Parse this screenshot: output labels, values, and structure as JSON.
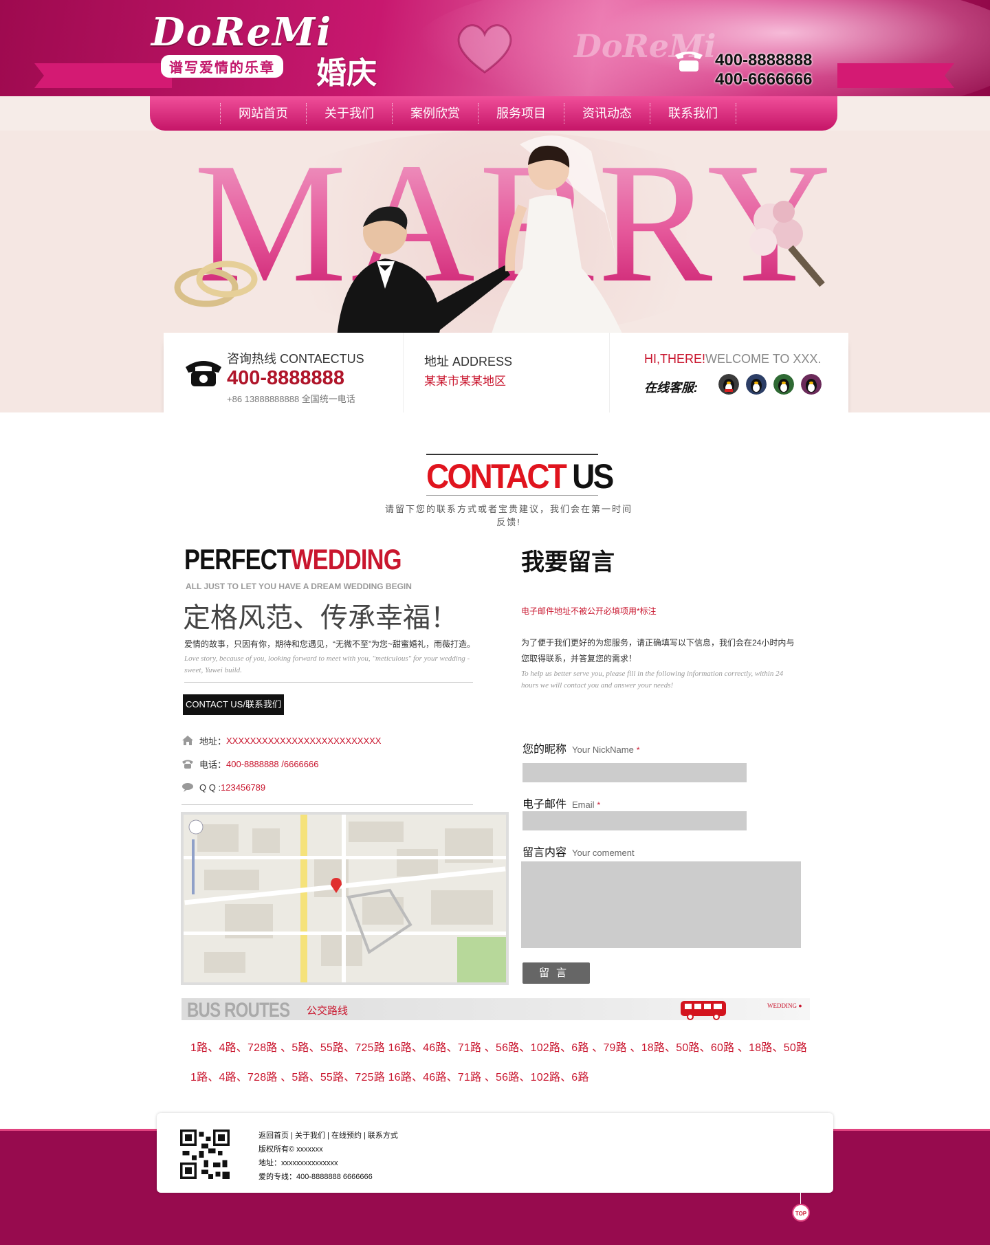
{
  "header": {
    "logo_text": "DoReMi",
    "logo_slogan": "谱写爱情的乐章",
    "logo_cn": "婚庆",
    "phone_1": "400-8888888",
    "phone_2": "400-6666666"
  },
  "nav": {
    "items": [
      "网站首页",
      "关于我们",
      "案例欣赏",
      "服务项目",
      "资讯动态",
      "联系我们"
    ]
  },
  "banner": {
    "word": "MARRY"
  },
  "infobar": {
    "hotline_label": "咨询热线 CONTAECTUS",
    "hotline_number": "400-8888888",
    "hotline_sub": "+86 13888888888 全国统一电话",
    "address_label": "地址 ADDRESS",
    "address_value": "某某市某某地区",
    "welcome_hi": "HI,THERE!",
    "welcome_rest": "WELCOME TO XXX.",
    "online_label": "在线客服:"
  },
  "contact_heading": {
    "title_red": "CONTACT",
    "title_black": "US",
    "subtitle": "请留下您的联系方式或者宝贵建议，我们会在第一时间反馈!"
  },
  "left": {
    "pw_black": "PERFECT",
    "pw_red": "WEDDING",
    "pw_sub": "ALL JUST  TO LET YOU HAVE A DREAM WEDDING BEGIN",
    "slogan": "定格风范、传承幸福！",
    "desc_cn": "爱情的故事，只因有你，期待和您遇见，“无微不至”为您~甜蜜婚礼，雨薇打造。",
    "desc_en": "Love story, because of you, looking forward to meet with you, \"meticulous\" for your wedding - sweet, Yuwei build.",
    "badge": "CONTACT US/联系我们",
    "address_label": "地址：",
    "address_value": "XXXXXXXXXXXXXXXXXXXXXXXXXX",
    "phone_label": "电话：",
    "phone_value": "400-8888888 /6666666",
    "qq_label": "Q  Q :",
    "qq_value": "123456789"
  },
  "right": {
    "title": "我要留言",
    "note": "电子邮件地址不被公开必填项用*标注",
    "desc_cn": "为了便于我们更好的为您服务，请正确填写以下信息，我们会在24小时内与您取得联系，并答复您的需求！",
    "desc_en": "To help us better serve you, please fill in the following information correctly, within 24 hours we will contact you and answer your needs!",
    "nick_label": "您的昵称",
    "nick_en": "Your NickName",
    "email_label": "电子邮件",
    "email_en": "Email",
    "comment_label": "留言内容",
    "comment_en": "Your comement",
    "required_mark": "*",
    "submit": "留言"
  },
  "bus": {
    "title_en": "BUS ROUTES",
    "title_cn": "公交路线",
    "tag": "WEDDING",
    "line1": "1路、4路、728路 、5路、55路、725路  16路、46路、71路 、56路、102路、6路 、79路 、18路、50路、60路 、18路、50路",
    "line2": "1路、4路、728路 、5路、55路、725路  16路、46路、71路 、56路、102路、6路"
  },
  "footer": {
    "links": "返回首页 | 关于我们 | 在线预约 | 联系方式",
    "copyright": "版权所有©    xxxxxxx",
    "address": "地址：xxxxxxxxxxxxxxx",
    "hotline": "爱的专线：400-8888888 6666666",
    "top": "TOP"
  },
  "colors": {
    "brand_pink": "#c8186f",
    "accent_red": "#c9162e",
    "footer_bg": "#970b4e"
  }
}
